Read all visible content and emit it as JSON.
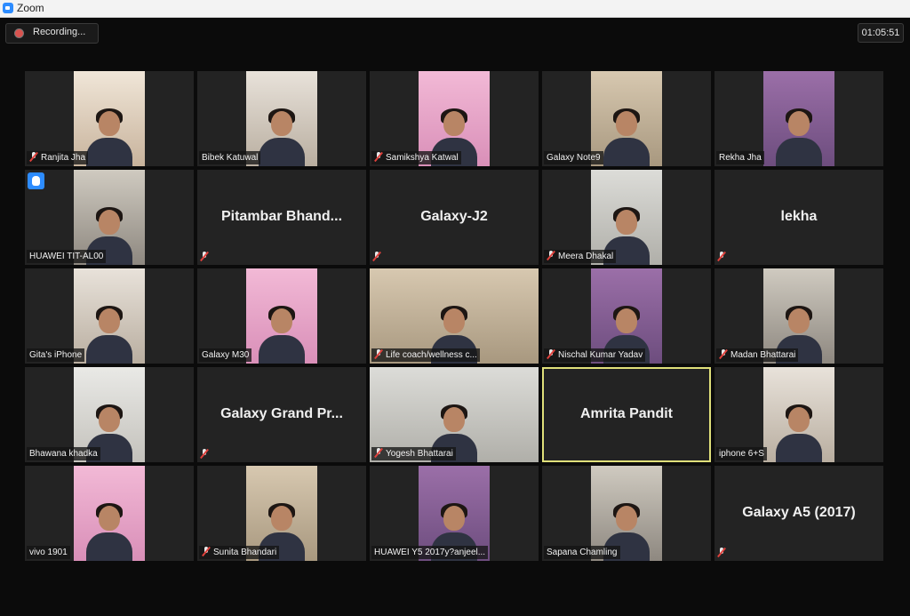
{
  "window": {
    "title": "Zoom"
  },
  "recording": {
    "label": "Recording..."
  },
  "timer": "01:05:51",
  "participants": [
    {
      "name": "Ranjita Jha",
      "video": true,
      "muted": true
    },
    {
      "name": "Bibek Katuwal",
      "video": true,
      "muted": false
    },
    {
      "name": "Samikshya Katwal",
      "video": true,
      "muted": true
    },
    {
      "name": "Galaxy Note9",
      "video": true,
      "muted": false
    },
    {
      "name": "Rekha Jha",
      "video": true,
      "muted": false
    },
    {
      "name": "HUAWEI TIT-AL00",
      "video": true,
      "muted": false,
      "hand_raised": true
    },
    {
      "name": "Pitambar  Bhand...",
      "video": false,
      "muted": true
    },
    {
      "name": "Galaxy-J2",
      "video": false,
      "muted": true
    },
    {
      "name": "Meera Dhakal",
      "video": true,
      "muted": true
    },
    {
      "name": "lekha",
      "video": false,
      "muted": true
    },
    {
      "name": "Gita's iPhone",
      "video": true,
      "muted": false
    },
    {
      "name": "Galaxy M30",
      "video": true,
      "muted": false
    },
    {
      "name": "Life coach/wellness c...",
      "video": true,
      "muted": true,
      "wide": true
    },
    {
      "name": "Nischal Kumar Yadav",
      "video": true,
      "muted": true
    },
    {
      "name": "Madan  Bhattarai",
      "video": true,
      "muted": true
    },
    {
      "name": "Bhawana khadka",
      "video": true,
      "muted": false
    },
    {
      "name": "Galaxy Grand Pr...",
      "video": false,
      "muted": true
    },
    {
      "name": "Yogesh Bhattarai",
      "video": true,
      "muted": true,
      "wide": true
    },
    {
      "name": "Amrita Pandit",
      "video": false,
      "muted": false,
      "active_speaker": true
    },
    {
      "name": "iphone 6+S",
      "video": true,
      "muted": false
    },
    {
      "name": "vivo 1901",
      "video": true,
      "muted": false
    },
    {
      "name": "Sunita Bhandari",
      "video": true,
      "muted": true
    },
    {
      "name": "HUAWEI Y5 2017y?anjeel...",
      "video": true,
      "muted": false
    },
    {
      "name": "Sapana Chamling",
      "video": true,
      "muted": false
    },
    {
      "name": "Galaxy A5 (2017)",
      "video": false,
      "muted": true
    }
  ]
}
